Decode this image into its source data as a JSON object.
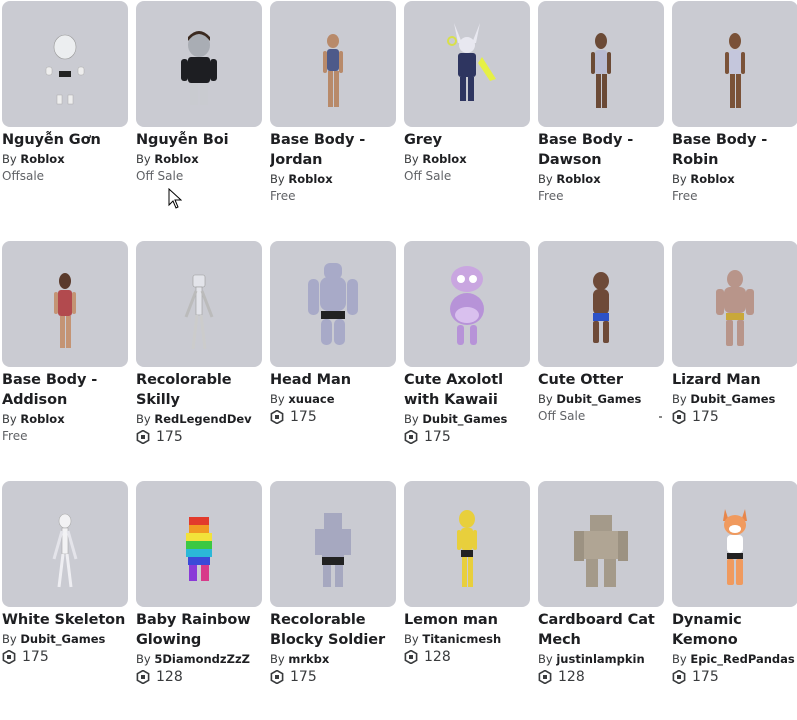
{
  "row1": [
    {
      "name": "Nguyễn Gơn",
      "by": "By",
      "creator": "Roblox",
      "price": "Offsale",
      "robux": false
    },
    {
      "name": "Nguyễn Boi",
      "by": "By",
      "creator": "Roblox",
      "price": "Off Sale",
      "robux": false
    },
    {
      "name": "Base Body - Jordan",
      "by": "By",
      "creator": "Roblox",
      "price": "Free",
      "robux": false
    },
    {
      "name": "Grey",
      "by": "By",
      "creator": "Roblox",
      "price": "Off Sale",
      "robux": false
    },
    {
      "name": "Base Body - Dawson",
      "by": "By",
      "creator": "Roblox",
      "price": "Free",
      "robux": false
    },
    {
      "name": "Base Body - Robin",
      "by": "By",
      "creator": "Roblox",
      "price": "Free",
      "robux": false
    }
  ],
  "row2": [
    {
      "name": "Base Body - Addison",
      "by": "By",
      "creator": "Roblox",
      "price": "Free",
      "robux": false
    },
    {
      "name": "Recolorable Skilly",
      "by": "By",
      "creator": "RedLegendDev",
      "price": "175",
      "robux": true
    },
    {
      "name": "Head Man",
      "by": "By",
      "creator": "xuuace",
      "price": "175",
      "robux": true
    },
    {
      "name": "Cute Axolotl with Kawaii Eyes",
      "by": "By",
      "creator": "Dubit_Games",
      "price": "175",
      "robux": true
    },
    {
      "name": "Cute Otter",
      "by": "By",
      "creator": "Dubit_Games",
      "price": "Off Sale",
      "robux": false
    },
    {
      "name": "Lizard Man",
      "by": "By",
      "creator": "Dubit_Games",
      "price": "175",
      "robux": true
    }
  ],
  "row3": [
    {
      "name": "White Skeleton",
      "by": "By",
      "creator": "Dubit_Games",
      "price": "175",
      "robux": true
    },
    {
      "name": "Baby Rainbow Glowing Goober!",
      "by": "By",
      "creator": "5DiamondzZzZ",
      "price": "128",
      "robux": true
    },
    {
      "name": "Recolorable Blocky Soldier",
      "by": "By",
      "creator": "mrkbx",
      "price": "175",
      "robux": true
    },
    {
      "name": "Lemon man",
      "by": "By",
      "creator": "Titanicmesh",
      "price": "128",
      "robux": true
    },
    {
      "name": "Cardboard Cat Mech",
      "by": "By",
      "creator": "justinlampkin",
      "price": "128",
      "robux": true
    },
    {
      "name": "Dynamic Kemono Shiba...",
      "by": "By",
      "creator": "Epic_RedPandas",
      "price": "175",
      "robux": true
    }
  ],
  "colors": {
    "thumb_bg": "#cacbd2",
    "text": "#1e1f22",
    "muted": "#606266"
  }
}
